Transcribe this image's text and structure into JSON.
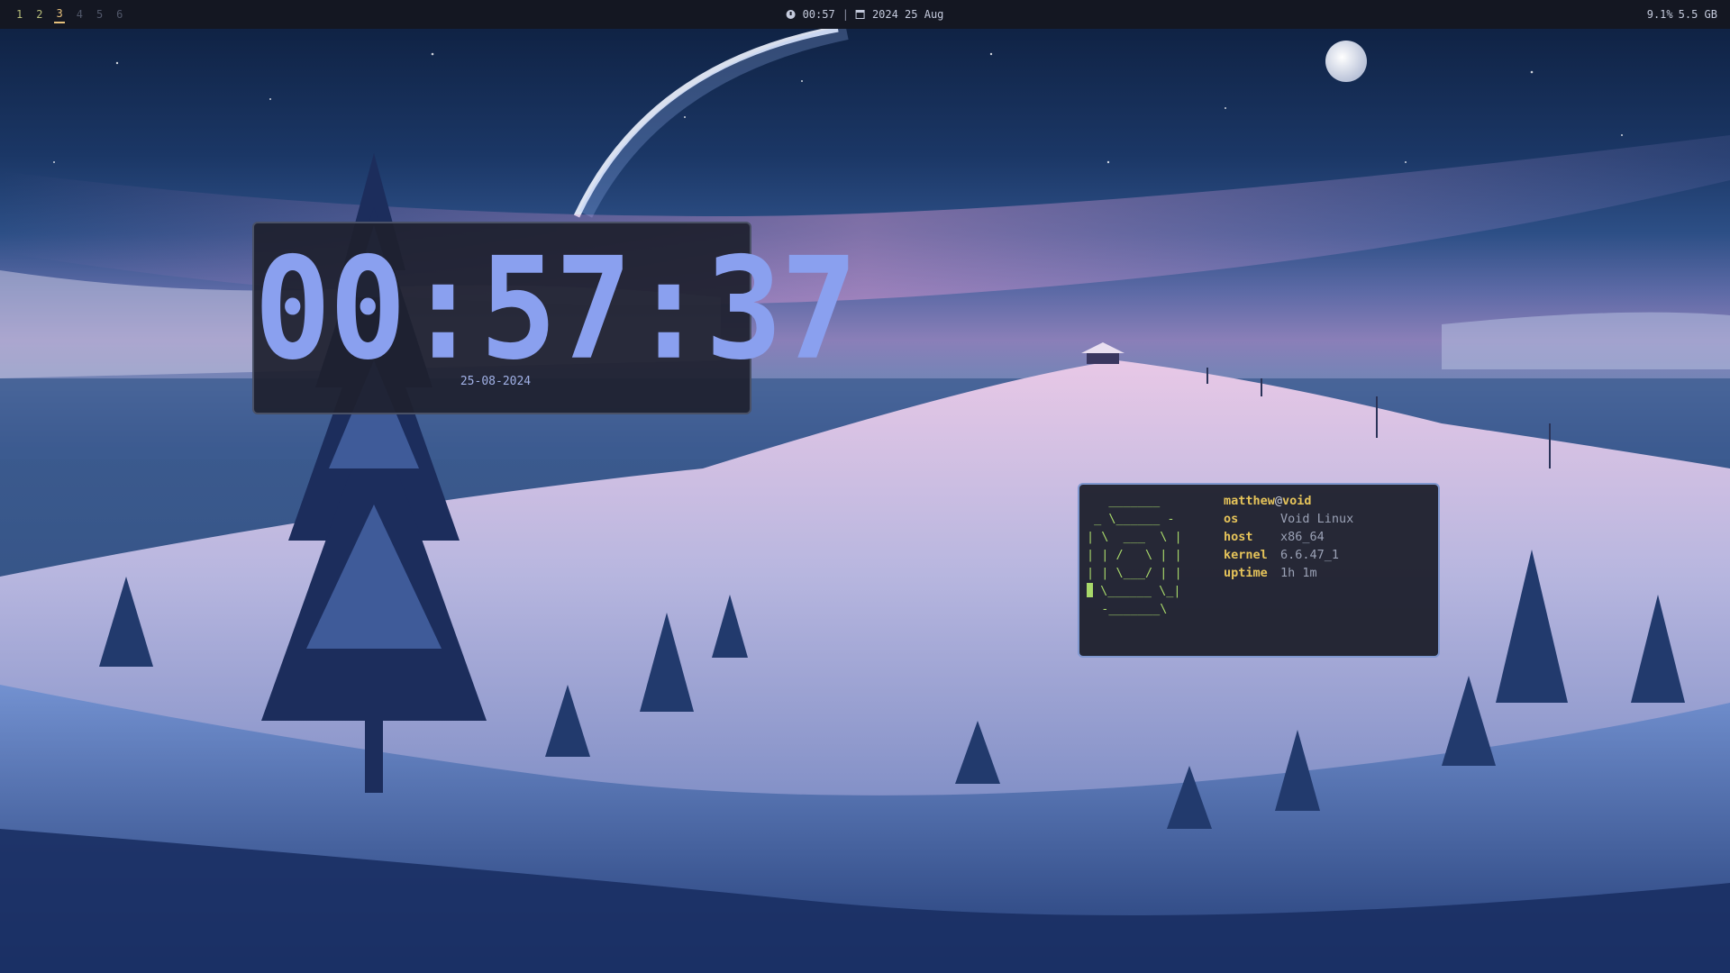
{
  "topbar": {
    "workspaces": [
      "1",
      "2",
      "3",
      "4",
      "5",
      "6"
    ],
    "active_workspace": "3",
    "time": "00:57",
    "separator": "|",
    "date": "2024 25 Aug",
    "cpu": "9.1%",
    "memory": "5.5 GB",
    "icons": [
      "clock-icon",
      "calendar-icon"
    ]
  },
  "clock_widget": {
    "time": "00:57:37",
    "date": "25-08-2024"
  },
  "terminal": {
    "ascii_logo": "   _______\n _ \\______ -\n| \\  ___  \\ |\n| | /   \\ | |\n| | \\___/ | |\n",
    "ascii_last": " \\______ \\_|",
    "ascii_tail": "  -_______\\",
    "user": "matthew",
    "at": "@",
    "host_name": "void",
    "rows": [
      {
        "key": "os",
        "value": "Void Linux"
      },
      {
        "key": "host",
        "value": "x86_64"
      },
      {
        "key": "kernel",
        "value": "6.6.47_1"
      },
      {
        "key": "uptime",
        "value": "1h 1m"
      }
    ]
  },
  "colors": {
    "bar_bg": "#141722",
    "clock_digits": "#8aa0ef",
    "terminal_green": "#a8d86a",
    "terminal_yellow": "#e6c45a",
    "terminal_border": "#7f97cf"
  }
}
